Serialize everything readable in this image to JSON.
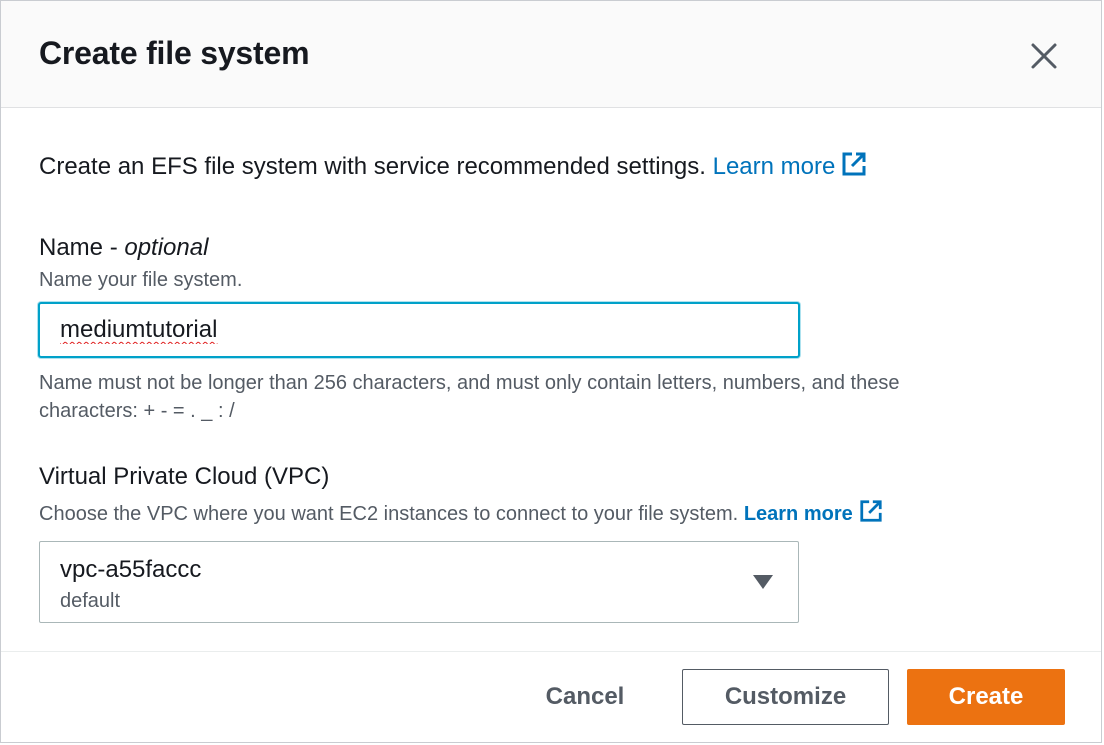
{
  "dialog": {
    "title": "Create file system",
    "close_icon": "close-icon"
  },
  "intro": {
    "text": "Create an EFS file system with service recommended settings.",
    "learn_more": "Learn more",
    "link_icon": "external-link-icon"
  },
  "name_field": {
    "label": "Name -",
    "label_optional": "optional",
    "description": "Name your file system.",
    "value": "mediumtutorial",
    "constraint_line1": "Name must not be longer than 256 characters, and must only contain letters, numbers, and these",
    "constraint_line2": "characters: + - = . _ : /"
  },
  "vpc_field": {
    "label": "Virtual Private Cloud (VPC)",
    "description": "Choose the VPC where you want EC2 instances to connect to your file system.",
    "learn_more": "Learn more",
    "link_icon": "external-link-icon",
    "selected_value": "vpc-a55faccc",
    "selected_sublabel": "default",
    "caret_icon": "caret-down-icon"
  },
  "footer": {
    "cancel_label": "Cancel",
    "customize_label": "Customize",
    "create_label": "Create"
  },
  "colors": {
    "primary_button": "#ec7211",
    "link": "#0073bb",
    "focus_border": "#00a1c9",
    "header_background": "#fafafa"
  }
}
